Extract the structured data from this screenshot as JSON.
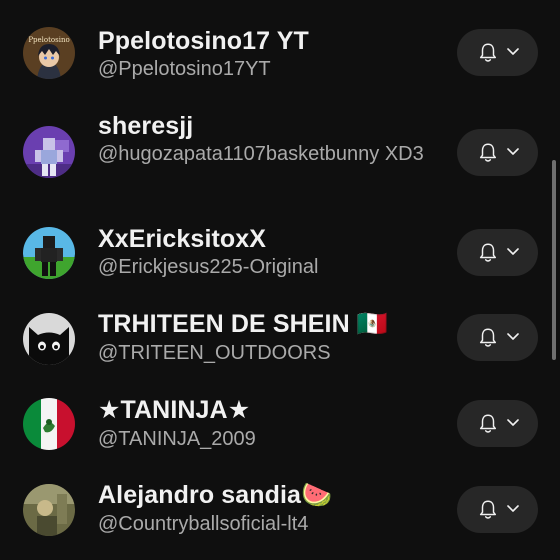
{
  "channels": [
    {
      "name": "Ppelotosino17 YT",
      "handle": "@Ppelotosino17YT",
      "avatar_text": "Ppelotosino",
      "avatar_icon": "cartoon-character-avatar"
    },
    {
      "name": "sheresjj",
      "handle": "@hugozapata1107basketbunny XD3",
      "avatar_icon": "roblox-character-purple-avatar"
    },
    {
      "name": "XxEricksitoxX",
      "handle": "@Erickjesus225-Original",
      "avatar_icon": "roblox-character-green-avatar"
    },
    {
      "name": "TRHITEEN DE SHEIN 🇲🇽",
      "handle": "@TRITEEN_OUTDOORS",
      "avatar_icon": "black-cat-avatar"
    },
    {
      "name": "★TANINJA★",
      "handle": "@TANINJA_2009",
      "avatar_icon": "mexico-flag-avatar"
    },
    {
      "name": "Alejandro sandia🍉",
      "handle": "@Countryballsoficial-lt4",
      "avatar_icon": "photo-avatar"
    }
  ],
  "notification_button": {
    "bell_icon": "bell-icon",
    "chevron_icon": "chevron-down-icon"
  },
  "colors": {
    "background": "#0f0f0f",
    "button": "#272727",
    "text_primary": "#f1f1f1",
    "text_secondary": "#aaaaaa"
  }
}
